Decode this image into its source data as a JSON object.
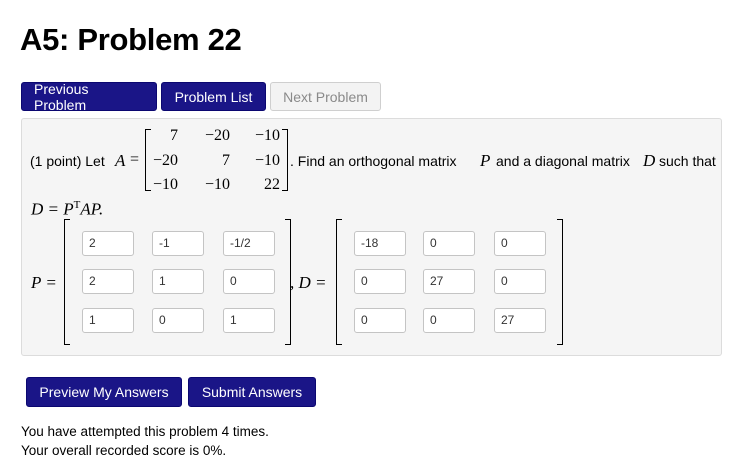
{
  "page": {
    "title": "A5: Problem 22"
  },
  "nav": {
    "previous": "Previous Problem",
    "list": "Problem List",
    "next": "Next Problem"
  },
  "problem": {
    "points": "(1 point) Let",
    "A_symbol": "A",
    "equals": "=",
    "matrix_A": [
      [
        "7",
        "−20",
        "−10"
      ],
      [
        "−20",
        "7",
        "−10"
      ],
      [
        "−10",
        "−10",
        "22"
      ]
    ],
    "find_text": ". Find an orthogonal matrix",
    "P_symbol": "P",
    "and_text": "and a diagonal matrix",
    "D_symbol": "D",
    "such_that": "such that",
    "equation": "D = P",
    "transpose": "T",
    "equation_end": "AP.",
    "P_label": "P =",
    "D_label": ", D =",
    "P_answers": [
      [
        "2",
        "-1",
        "-1/2"
      ],
      [
        "2",
        "1",
        "0"
      ],
      [
        "1",
        "0",
        "1"
      ]
    ],
    "D_answers": [
      [
        "-18",
        "0",
        "0"
      ],
      [
        "0",
        "27",
        "0"
      ],
      [
        "0",
        "0",
        "27"
      ]
    ]
  },
  "actions": {
    "preview": "Preview My Answers",
    "submit": "Submit Answers"
  },
  "status": {
    "attempts": "You have attempted this problem 4 times.",
    "score": "Your overall recorded score is 0%."
  },
  "colors": {
    "button_bg": "#1a1587",
    "panel_bg": "#f5f5f5"
  }
}
